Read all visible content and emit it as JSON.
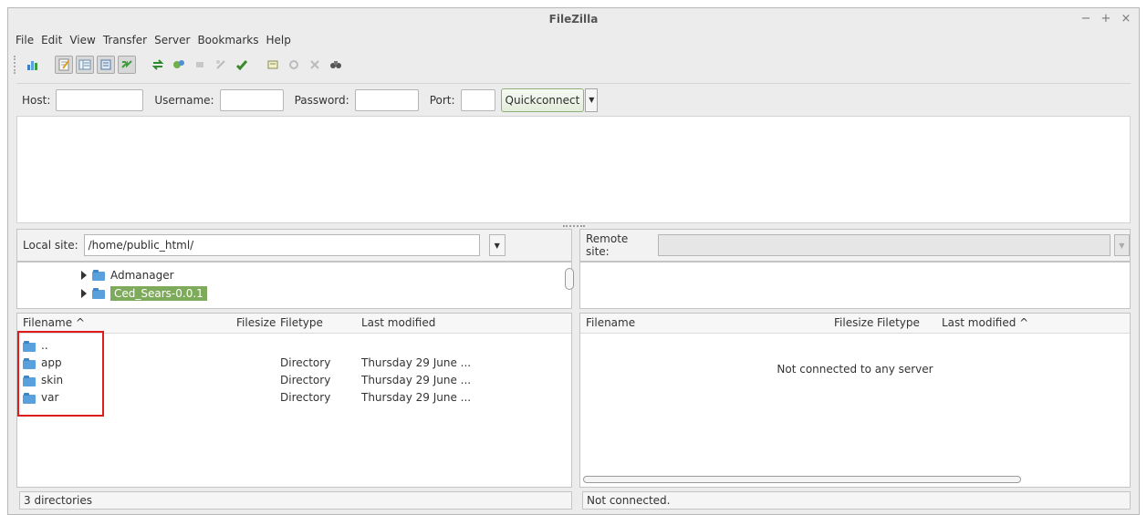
{
  "window": {
    "title": "FileZilla",
    "controls": [
      "−",
      "+",
      "×"
    ]
  },
  "menubar": {
    "items": [
      "File",
      "Edit",
      "View",
      "Transfer",
      "Server",
      "Bookmarks",
      "Help"
    ]
  },
  "toolbar": {
    "icons": [
      "site-manager-icon",
      "toggle-message-log-icon",
      "toggle-local-tree-icon",
      "toggle-remote-tree-icon",
      "toggle-transfer-queue-icon",
      "refresh-icon",
      "process-queue-icon",
      "cancel-operation-icon",
      "disconnect-icon",
      "reconnect-icon",
      "directory-filters-icon",
      "sync-browsing-icon",
      "compare-dirs-icon",
      "search-icon"
    ]
  },
  "quickconnect": {
    "host_label": "Host:",
    "host_value": "",
    "username_label": "Username:",
    "username_value": "",
    "password_label": "Password:",
    "password_value": "",
    "port_label": "Port:",
    "port_value": "",
    "button_label": "Quickconnect"
  },
  "local": {
    "site_label": "Local site:",
    "site_path": "/home/public_html/",
    "tree": [
      {
        "label": "Admanager",
        "selected": false
      },
      {
        "label": "Ced_Sears-0.0.1",
        "selected": true
      }
    ],
    "columns": {
      "filename": "Filename ^",
      "filesize": "Filesize",
      "filetype": "Filetype",
      "last_modified": "Last modified"
    },
    "files": [
      {
        "name": "..",
        "size": "",
        "type": "",
        "modified": ""
      },
      {
        "name": "app",
        "size": "",
        "type": "Directory",
        "modified": "Thursday 29 June ..."
      },
      {
        "name": "skin",
        "size": "",
        "type": "Directory",
        "modified": "Thursday 29 June ..."
      },
      {
        "name": "var",
        "size": "",
        "type": "Directory",
        "modified": "Thursday 29 June ..."
      }
    ],
    "status": "3 directories"
  },
  "remote": {
    "site_label": "Remote site:",
    "site_path": "",
    "columns": {
      "filename": "Filename",
      "filesize": "Filesize",
      "filetype": "Filetype",
      "last_modified": "Last modified ^"
    },
    "empty_message": "Not connected to any server",
    "status": "Not connected."
  },
  "colors": {
    "accent_selected": "#7eaa5c",
    "highlight_box": "#e01b1b",
    "folder": "#5aa0dc"
  }
}
